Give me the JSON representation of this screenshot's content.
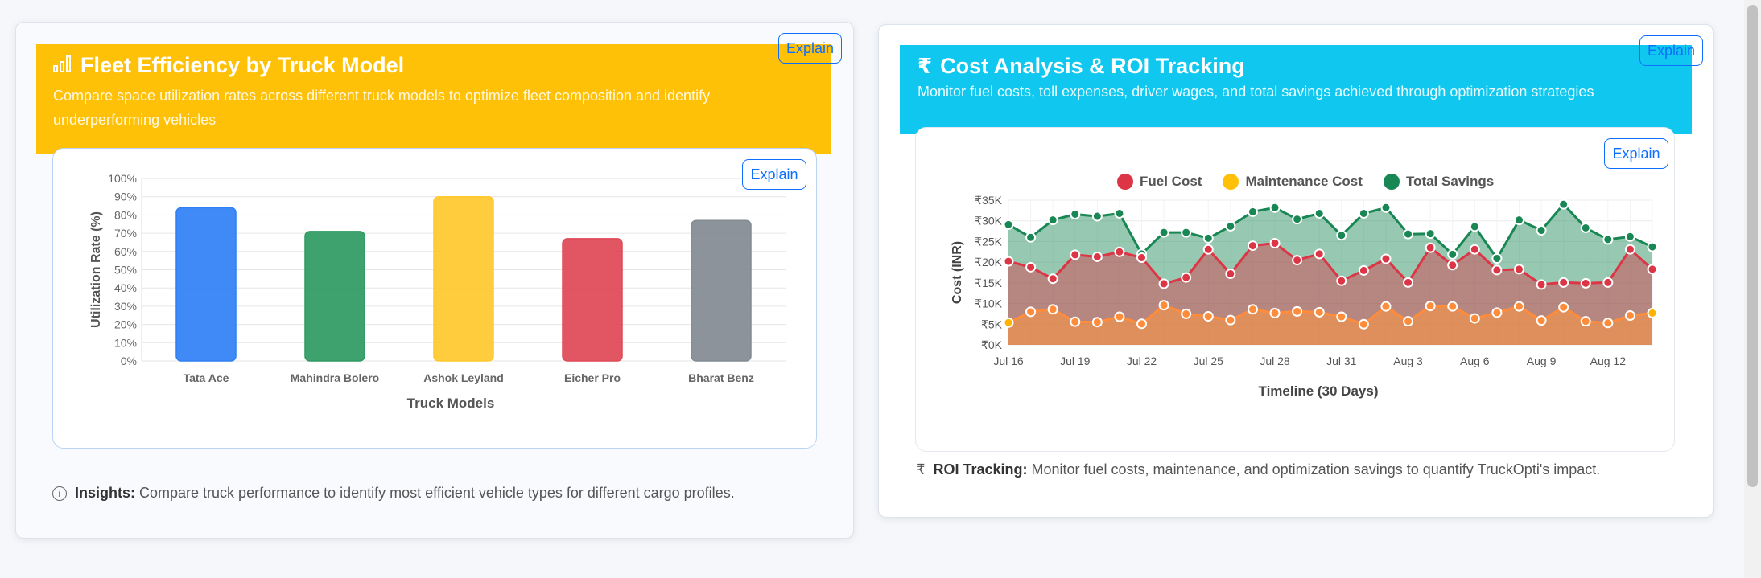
{
  "explain_label": "Explain",
  "fleet": {
    "title": "Fleet Efficiency by Truck Model",
    "title_icon": "bar-chart-icon",
    "description": "Compare space utilization rates across different truck models to optimize fleet composition and identify underperforming vehicles",
    "insight_label": "Insights:",
    "insight_text": "Compare truck performance to identify most efficient vehicle types for different cargo profiles."
  },
  "cost": {
    "title": "Cost Analysis & ROI Tracking",
    "title_icon": "rupee-icon",
    "title_symbol": "₹",
    "description": "Monitor fuel costs, toll expenses, driver wages, and total savings achieved through optimization strategies",
    "roi_label": "ROI Tracking:",
    "roi_text": "Monitor fuel costs, maintenance, and optimization savings to quantify TruckOpti's impact."
  },
  "colors": {
    "amber": "#ffc107",
    "cyan": "#10c8ef",
    "accent_blue": "#0d6efd",
    "fuel": "#dc3545",
    "maintenance": "#ffc107",
    "savings": "#198754"
  },
  "chart_data": [
    {
      "type": "bar",
      "categories": [
        "Tata Ace",
        "Mahindra Bolero",
        "Ashok Leyland",
        "Eicher Pro",
        "Bharat Benz"
      ],
      "values": [
        84,
        71,
        90,
        67,
        77
      ],
      "colors": [
        "#2f80f6",
        "#2e9a63",
        "#ffc82c",
        "#e04856",
        "#828a92"
      ],
      "xlabel": "Truck Models",
      "ylabel": "Utilization Rate (%)",
      "ylim": [
        0,
        100
      ],
      "yticks": [
        "0%",
        "10%",
        "20%",
        "30%",
        "40%",
        "50%",
        "60%",
        "70%",
        "80%",
        "90%",
        "100%"
      ],
      "grid": true
    },
    {
      "type": "area",
      "xlabel": "Timeline (30 Days)",
      "ylabel": "Cost (INR)",
      "ylim": [
        0,
        35000
      ],
      "yticks": [
        "₹0K",
        "₹5K",
        "₹10K",
        "₹15K",
        "₹20K",
        "₹25K",
        "₹30K",
        "₹35K"
      ],
      "xticks": [
        "Jul 16",
        "Jul 19",
        "Jul 22",
        "Jul 25",
        "Jul 28",
        "Jul 31",
        "Aug 3",
        "Aug 6",
        "Aug 9",
        "Aug 12"
      ],
      "x": [
        "Jul 16",
        "Jul 17",
        "Jul 18",
        "Jul 19",
        "Jul 20",
        "Jul 21",
        "Jul 22",
        "Jul 23",
        "Jul 24",
        "Jul 25",
        "Jul 26",
        "Jul 27",
        "Jul 28",
        "Jul 29",
        "Jul 30",
        "Jul 31",
        "Aug 1",
        "Aug 2",
        "Aug 3",
        "Aug 4",
        "Aug 5",
        "Aug 6",
        "Aug 7",
        "Aug 8",
        "Aug 9",
        "Aug 10",
        "Aug 11",
        "Aug 12",
        "Aug 13",
        "Aug 14"
      ],
      "legend": "top",
      "grid": true,
      "series": [
        {
          "name": "Fuel Cost",
          "color": "#dc3545",
          "values": [
            20200,
            18800,
            16000,
            21800,
            21300,
            22500,
            21100,
            14800,
            16300,
            23100,
            17200,
            24000,
            24600,
            20500,
            22000,
            15500,
            18000,
            20800,
            15100,
            23500,
            19300,
            23100,
            18100,
            18300,
            14600,
            15100,
            14900,
            15100,
            23100,
            18300
          ]
        },
        {
          "name": "Maintenance Cost",
          "color": "#ffc107",
          "values": [
            5400,
            8000,
            8600,
            5600,
            5500,
            6800,
            5100,
            9600,
            7500,
            6900,
            6000,
            8600,
            7700,
            8100,
            7900,
            6800,
            5000,
            9300,
            5700,
            9400,
            9300,
            6400,
            7800,
            9300,
            5900,
            9100,
            5700,
            5300,
            7100,
            7700
          ]
        },
        {
          "name": "Total Savings",
          "color": "#198754",
          "values": [
            29100,
            26000,
            30200,
            31600,
            31100,
            31800,
            22000,
            27200,
            27200,
            25800,
            28700,
            32200,
            33200,
            30400,
            31800,
            26500,
            31800,
            33200,
            26800,
            26900,
            21900,
            28600,
            20900,
            30200,
            27700,
            34000,
            28300,
            25500,
            26200,
            23700
          ]
        }
      ]
    }
  ]
}
